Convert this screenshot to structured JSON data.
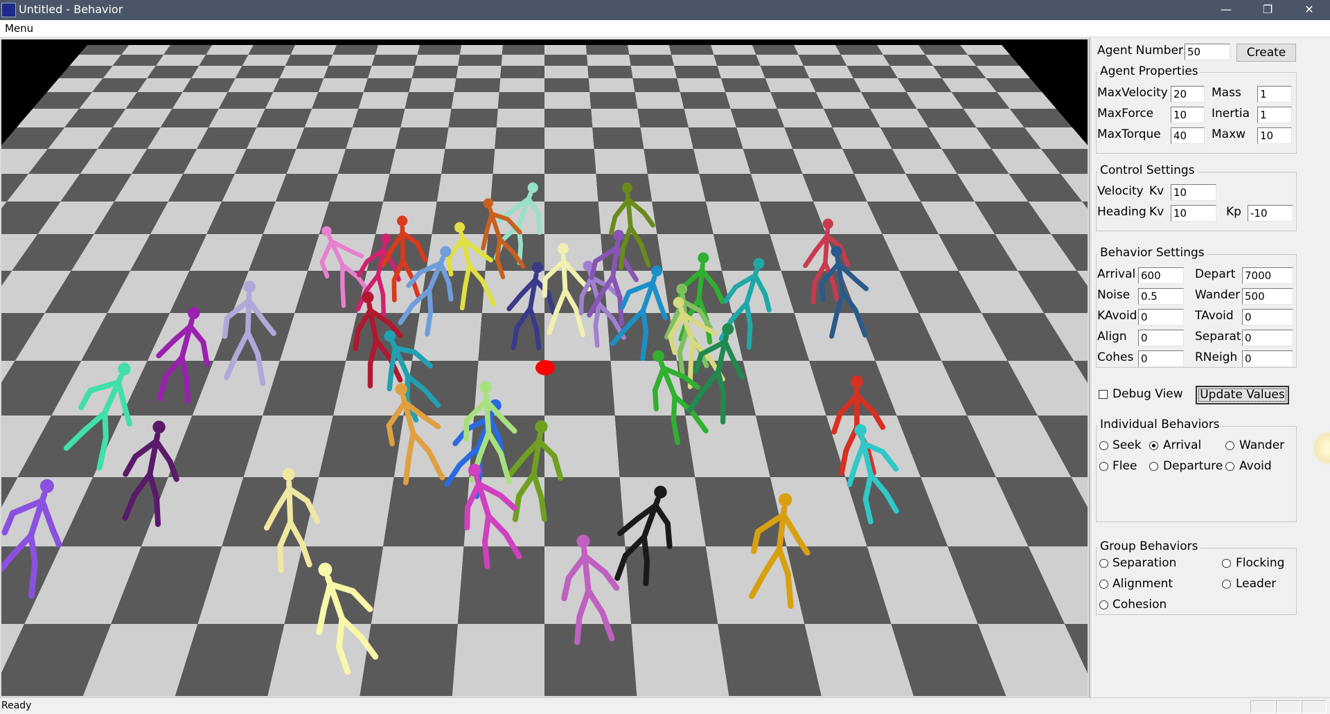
{
  "window": {
    "title": "Untitled - Behavior",
    "app_icon": "behavior-app-icon",
    "controls": [
      "minimize-icon",
      "restore-icon",
      "close-icon"
    ]
  },
  "menubar": {
    "items": [
      "Menu"
    ]
  },
  "scene": {
    "floor": "checkerboard",
    "floor_colors": [
      "#5a5a5a",
      "#cfcfcf"
    ],
    "target_color": "#ff0000",
    "agent_colors": [
      "#e87fd0",
      "#d0206e",
      "#d83a1c",
      "#e0e040",
      "#6e9edb",
      "#3a3a8a",
      "#f0f0b0",
      "#a080d0",
      "#98e0c8",
      "#8855b5",
      "#6a8a1a",
      "#c86020",
      "#1a90c8",
      "#30b030",
      "#80c060",
      "#d8d880",
      "#20a8a8",
      "#c83a50",
      "#2a5a8a",
      "#30b030",
      "#9a20b0",
      "#b0a8d8",
      "#b01830",
      "#20a0b0",
      "#208a50",
      "#d83020",
      "#30c8c8",
      "#40e0a8",
      "#5a1a6a",
      "#f0e8a0",
      "#e0a040",
      "#2a6ae0",
      "#70a020",
      "#a8e080",
      "#d040c0",
      "#1a1a1a",
      "#d8a010",
      "#c060c0",
      "#f8f8a8",
      "#8a50e0"
    ]
  },
  "panel": {
    "agent_number_label": "Agent Number:",
    "agent_number_value": "50",
    "create_button": "Create",
    "agent_properties": {
      "title": "Agent Properties",
      "max_velocity_label": "MaxVelocity",
      "max_velocity": "20",
      "mass_label": "Mass",
      "mass": "1",
      "max_force_label": "MaxForce",
      "max_force": "10",
      "inertia_label": "Inertia",
      "inertia": "1",
      "max_torque_label": "MaxTorque",
      "max_torque": "40",
      "maxw_label": "Maxw",
      "maxw": "10"
    },
    "control_settings": {
      "title": "Control Settings",
      "velocity_label": "Velocity",
      "velocity_kv_label": "Kv",
      "velocity_kv": "10",
      "heading_label": "Heading",
      "heading_kv_label": "Kv",
      "heading_kv": "10",
      "kp_label": "Kp",
      "kp": "-10"
    },
    "behavior_settings": {
      "title": "Behavior Settings",
      "arrival_label": "Arrival",
      "arrival": "600",
      "depart_label": "Depart",
      "depart": "7000",
      "noise_label": "Noise",
      "noise": "0.5",
      "wander_label": "Wander",
      "wander": "500",
      "kavoid_label": "KAvoid",
      "kavoid": "0",
      "tavoid_label": "TAvoid",
      "tavoid": "0",
      "align_label": "Align",
      "align": "0",
      "separat_label": "Separat",
      "separat": "0",
      "cohes_label": "Cohes",
      "cohes": "0",
      "rneigh_label": "RNeigh",
      "rneigh": "0"
    },
    "debug_view_label": "Debug View",
    "debug_view_checked": false,
    "update_values_button": "Update Values",
    "individual_behaviors": {
      "title": "Individual Behaviors",
      "options": [
        "Seek",
        "Arrival",
        "Wander",
        "Flee",
        "Departure",
        "Avoid"
      ],
      "selected": "Arrival"
    },
    "group_behaviors": {
      "title": "Group Behaviors",
      "options": [
        "Separation",
        "Flocking",
        "Alignment",
        "Leader",
        "Cohesion"
      ],
      "selected": ""
    }
  },
  "status": {
    "text": "Ready"
  }
}
